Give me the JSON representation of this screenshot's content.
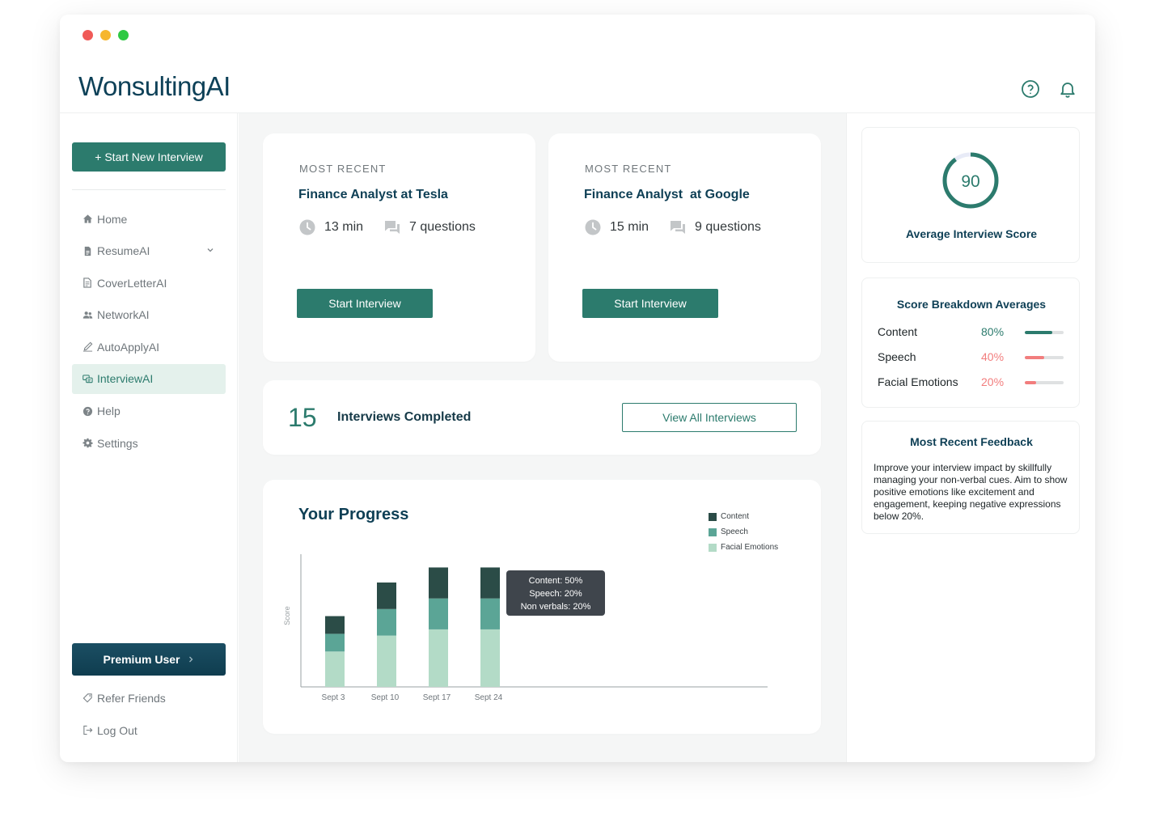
{
  "window": {
    "dots": [
      "#f05a57",
      "#f6b62d",
      "#2ec943"
    ]
  },
  "brand": {
    "logo_text": "WonsultingAI",
    "color": "#0e4158"
  },
  "topbar": {
    "icons": [
      "help-circle-icon",
      "bell-icon"
    ]
  },
  "sidebar": {
    "start_button": "+ Start New Interview",
    "items": [
      {
        "label": "Home",
        "icon": "home-icon"
      },
      {
        "label": "ResumeAI",
        "icon": "document-icon"
      },
      {
        "label": "CoverLetterAI",
        "icon": "cover-letter-icon"
      },
      {
        "label": "NetworkAI",
        "icon": "people-icon"
      },
      {
        "label": "AutoApplyAI",
        "icon": "pen-icon"
      },
      {
        "label": "InterviewAI",
        "icon": "chat-icon",
        "active": true
      },
      {
        "label": "Help",
        "icon": "question-icon"
      },
      {
        "label": "Settings",
        "icon": "gear-icon"
      }
    ],
    "premium_label": "Premium User",
    "refer_label": "Refer Friends",
    "logout_label": "Log Out"
  },
  "recent": [
    {
      "label": "MOST RECENT",
      "title": "Finance Analyst at Tesla",
      "duration": "13 min",
      "questions": "7 questions",
      "button": "Start Interview"
    },
    {
      "label": "MOST RECENT",
      "title": "Finance Analyst  at Google",
      "duration": "15 min",
      "questions": "9 questions",
      "button": "Start Interview"
    }
  ],
  "completed": {
    "count": "15",
    "label": "Interviews Completed",
    "button": "View All Interviews"
  },
  "progress": {
    "title": "Your Progress",
    "tooltip": [
      "Content: 50%",
      "Speech: 20%",
      "Non verbals: 20%"
    ]
  },
  "chart_data": {
    "type": "bar",
    "stacked": true,
    "categories": [
      "Sept 3",
      "Sept 10",
      "Sept 17",
      "Sept 24"
    ],
    "series": [
      {
        "name": "Content",
        "color": "#2b4c47",
        "values": [
          20,
          30,
          35,
          35
        ]
      },
      {
        "name": "Speech",
        "color": "#5ba596",
        "values": [
          20,
          30,
          35,
          35
        ]
      },
      {
        "name": "Facial Emotions",
        "color": "#b3dbc7",
        "values": [
          40,
          58,
          65,
          65
        ]
      }
    ],
    "title": "Your Progress",
    "xlabel": "",
    "ylabel": "Score",
    "ylim": [
      0,
      150
    ],
    "legend": "top-right",
    "grid": false
  },
  "score": {
    "value": "90",
    "fraction": 0.9,
    "label": "Average Interview Score",
    "color": "#2c7b6d"
  },
  "breakdown": {
    "title": "Score Breakdown Averages",
    "rows": [
      {
        "label": "Content",
        "pct": "80%",
        "fraction": 0.7,
        "color": "#2c7b6d"
      },
      {
        "label": "Speech",
        "pct": "40%",
        "fraction": 0.5,
        "color": "#f27d7d"
      },
      {
        "label": "Facial Emotions",
        "pct": "20%",
        "fraction": 0.3,
        "color": "#f27d7d"
      }
    ]
  },
  "feedback": {
    "title": "Most Recent Feedback",
    "text": "Improve your interview impact by skillfully managing your non-verbal cues. Aim to show positive emotions like excitement and engagement, keeping negative expressions below 20%."
  }
}
